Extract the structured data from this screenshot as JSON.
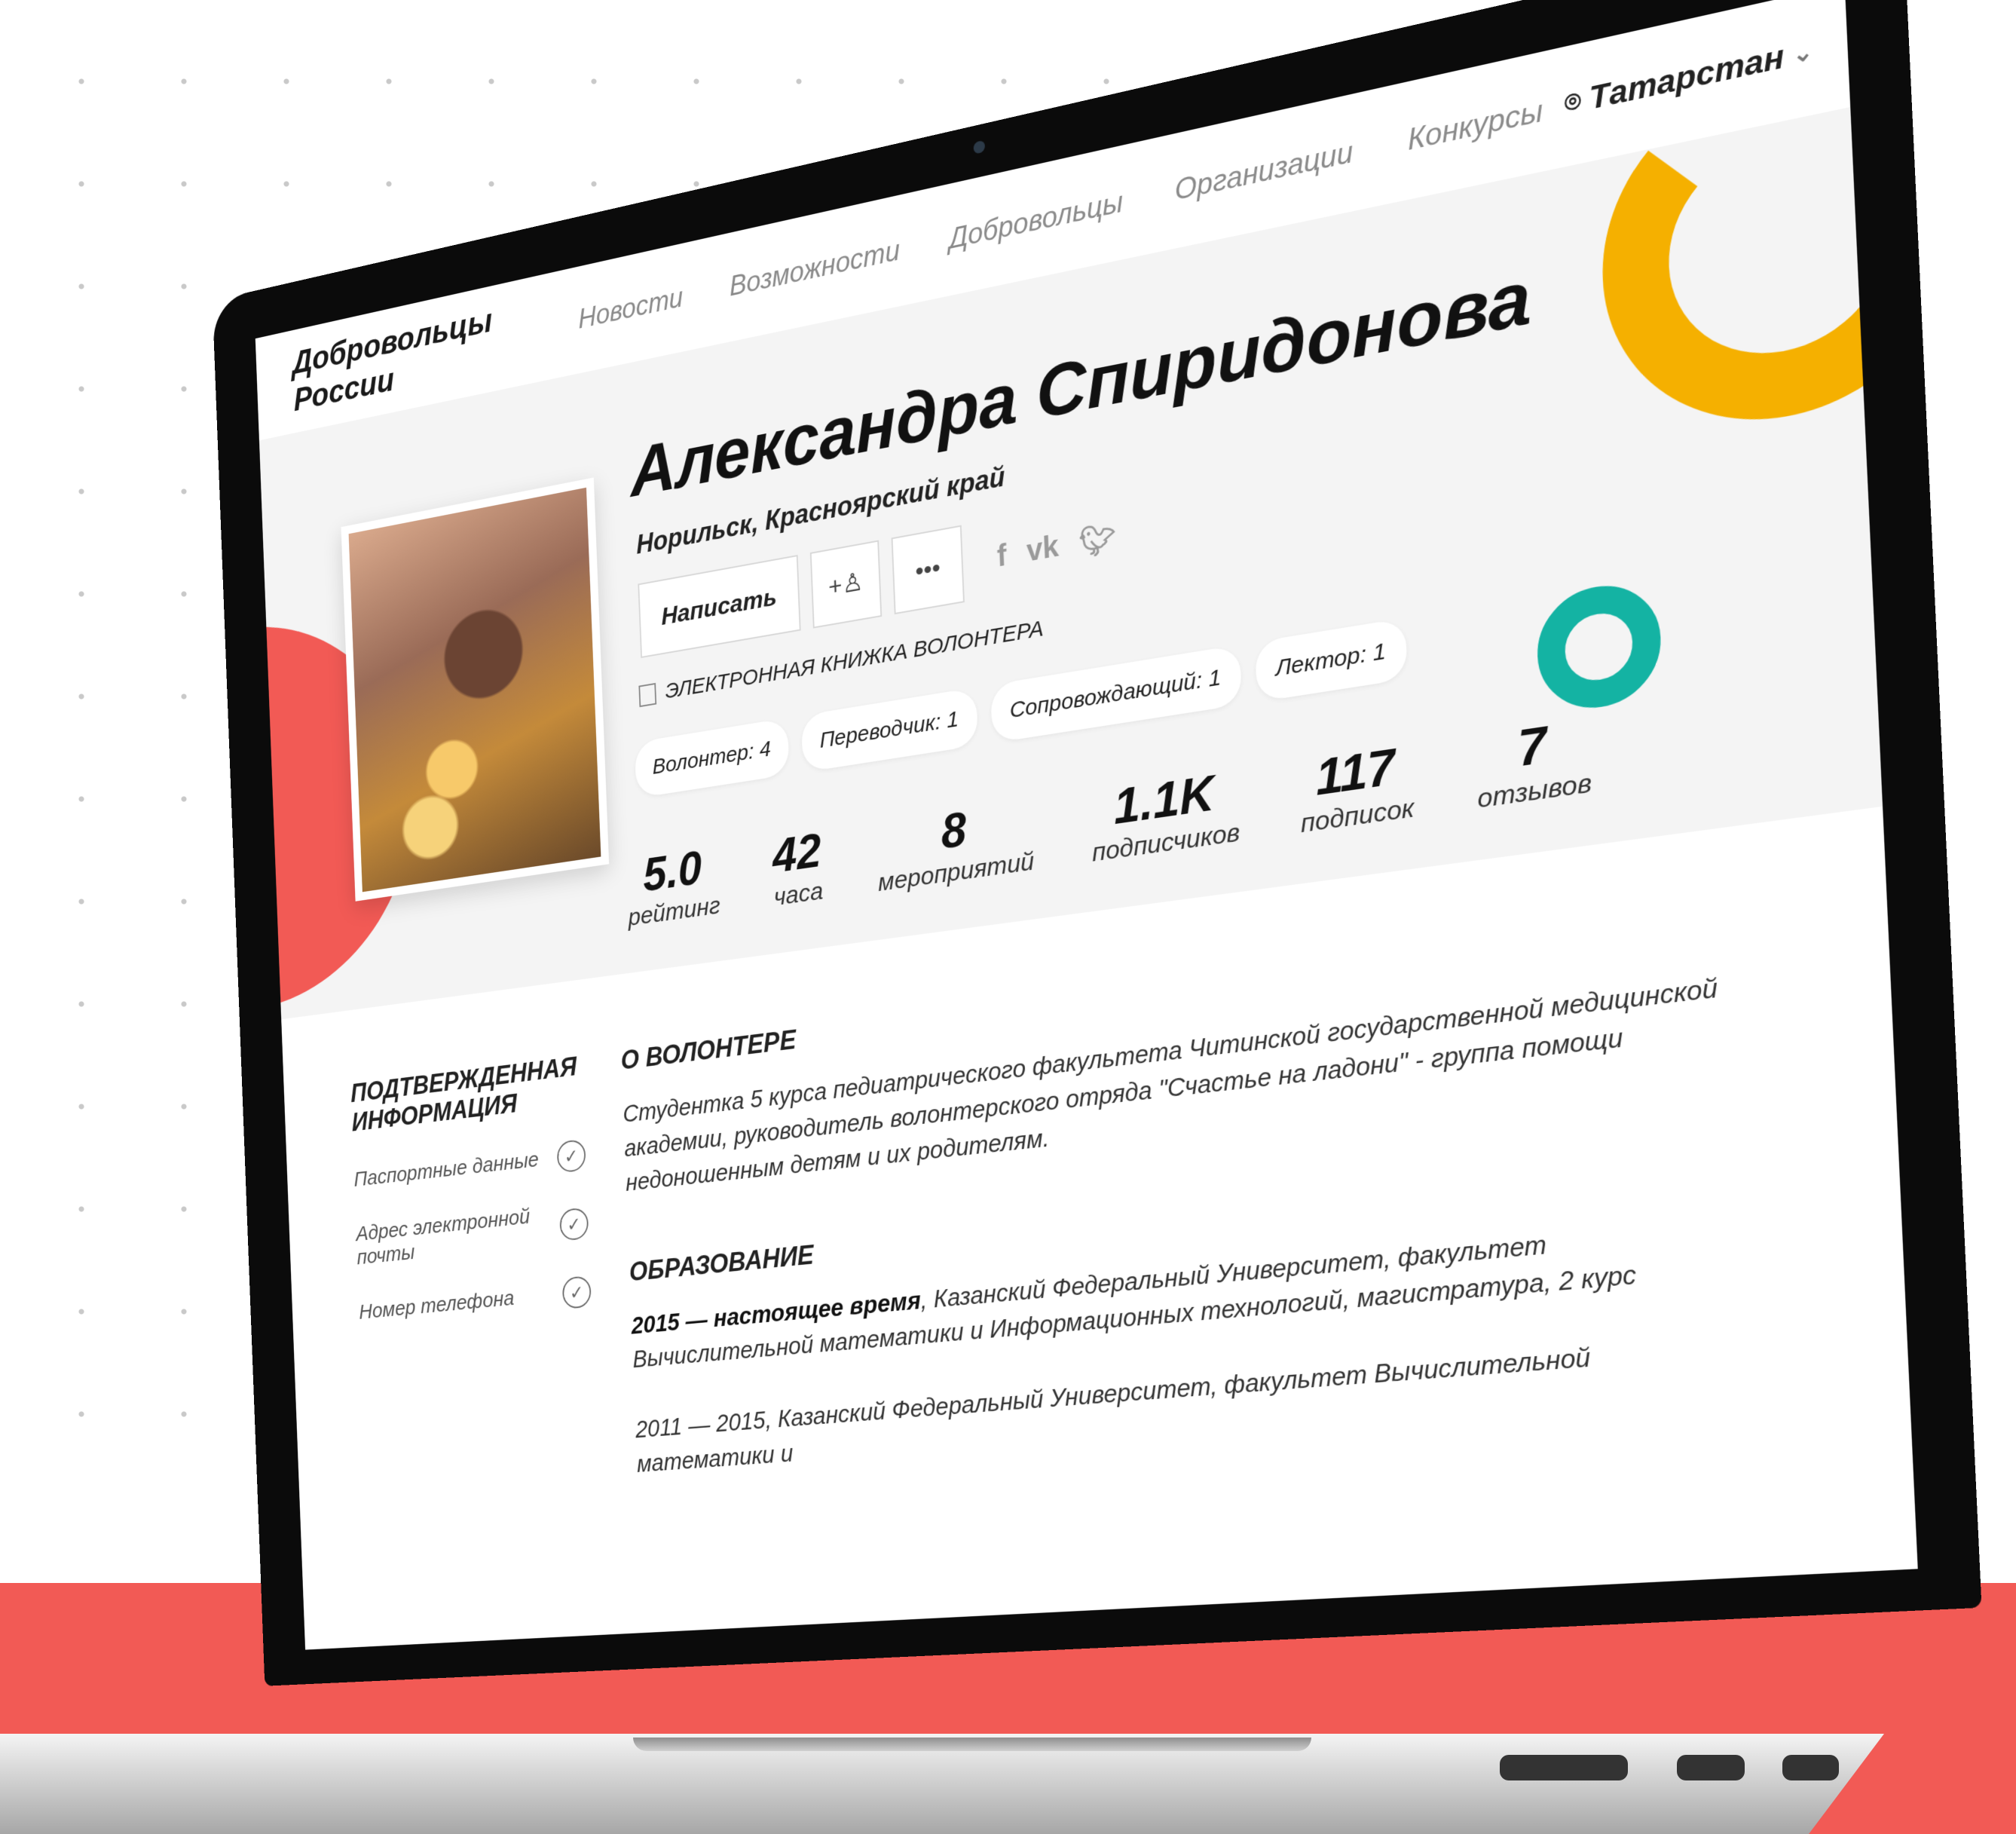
{
  "brand": "Добровольцы России",
  "nav": [
    "Новости",
    "Возможности",
    "Добровольцы",
    "Организации",
    "Конкурсы"
  ],
  "region": "Татарстан",
  "profile": {
    "name": "Александра Спиридонова",
    "location": "Норильск, Красноярский край",
    "write_label": "Написать",
    "add_friend_label": "+ႸႸ",
    "more_label": "•••",
    "ebook_label": "ЭЛЕКТРОННАЯ КНИЖКА ВОЛОНТЕРА",
    "tags": [
      "Волонтер: 4",
      "Переводчик: 1",
      "Сопровождающий: 1",
      "Лектор: 1"
    ]
  },
  "social": {
    "facebook": "f",
    "vk": "vk",
    "twitter": "t"
  },
  "stats": [
    {
      "value": "5.0",
      "label": "рейтинг"
    },
    {
      "value": "42",
      "label": "часа"
    },
    {
      "value": "8",
      "label": "мероприятий"
    },
    {
      "value": "1.1K",
      "label": "подписчиков"
    },
    {
      "value": "117",
      "label": "подписок"
    },
    {
      "value": "7",
      "label": "отзывов"
    }
  ],
  "verified": {
    "title": "ПОДТВЕРЖДЕННАЯ ИНФОРМАЦИЯ",
    "items": [
      "Паспортные данные",
      "Адрес электронной почты",
      "Номер телефона"
    ]
  },
  "about": {
    "title": "О ВОЛОНТЕРЕ",
    "text": "Студентка 5 курса педиатрического факультета Читинской государственной медицинской академии, руководитель волонтерского отряда \"Счастье на ладони\" - группа помощи недоношенным детям и их родителям."
  },
  "education": {
    "title": "ОБРАЗОВАНИЕ",
    "items": [
      {
        "years": "2015 — настоящее время",
        "text": ", Казанский Федеральный Университет, факультет Вычислительной математики и Информационных технологий, магистратура, 2 курс"
      },
      {
        "years": "2011 — 2015",
        "text": ", Казанский Федеральный Университет, факультет Вычислительной математики и"
      }
    ]
  },
  "colors": {
    "red": "#f25a55",
    "yellow": "#f5b000",
    "teal": "#14b3a3"
  }
}
